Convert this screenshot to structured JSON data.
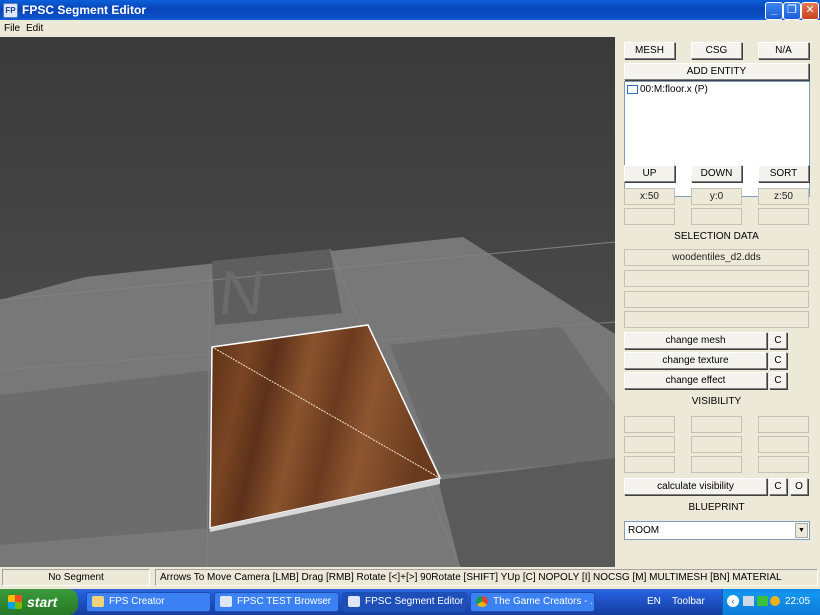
{
  "window": {
    "title": "FPSC Segment Editor",
    "app_icon": "fpsc-icon"
  },
  "menu": [
    "File",
    "Edit"
  ],
  "viewport": {
    "compass_letter": "N",
    "object_texture_color": "#6b3a1f"
  },
  "panel": {
    "top_buttons": [
      "MESH",
      "CSG",
      "N/A"
    ],
    "add_entity": "ADD ENTITY",
    "entity_list": [
      {
        "label": "00:M:floor.x (P)",
        "checked": false
      }
    ],
    "order_buttons": [
      "UP",
      "DOWN",
      "SORT"
    ],
    "coords": {
      "x": "x:50",
      "y": "y:0",
      "z": "z:50"
    },
    "selection_heading": "SELECTION DATA",
    "selection_fields": [
      "woodentiles_d2.dds",
      "",
      "",
      ""
    ],
    "change_mesh": "change mesh",
    "change_texture": "change texture",
    "change_effect": "change effect",
    "c_label": "C",
    "visibility_heading": "VISIBILITY",
    "calc_visibility": "calculate visibility",
    "o_label": "O",
    "blueprint_heading": "BLUEPRINT",
    "blueprint_value": "ROOM"
  },
  "status": {
    "segment": "No Segment",
    "help": "Arrows To Move Camera  [LMB] Drag  [RMB] Rotate  [<]+[>] 90Rotate  [SHIFT] YUp  [C] NOPOLY [I] NOCSG [M] MULTIMESH [BN] MATERIAL"
  },
  "taskbar": {
    "start": "start",
    "tasks": [
      {
        "label": "FPS Creator",
        "icon": "folder-icon",
        "active": false
      },
      {
        "label": "FPSC TEST Browser",
        "icon": "fpsc-icon",
        "active": false
      },
      {
        "label": "FPSC Segment Editor",
        "icon": "fpsc-icon",
        "active": true
      },
      {
        "label": "The Game Creators - ...",
        "icon": "chrome-icon",
        "active": false
      }
    ],
    "language": "EN",
    "toolbar_label": "Toolbar",
    "clock": "22:05"
  }
}
